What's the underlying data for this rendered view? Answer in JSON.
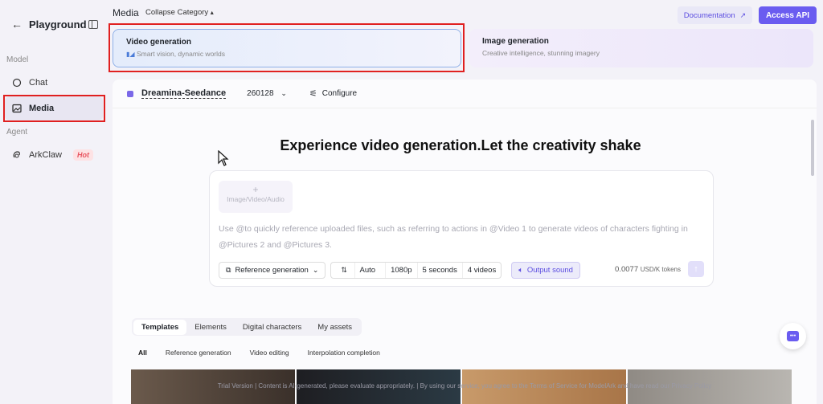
{
  "sidebar": {
    "title": "Playground",
    "sections": {
      "model": "Model",
      "agent": "Agent"
    },
    "items": [
      {
        "label": "Chat"
      },
      {
        "label": "Media"
      },
      {
        "label": "ArkClaw",
        "badge": "Hot"
      }
    ]
  },
  "header": {
    "title": "Media",
    "collapse_label": "Collapse Category",
    "documentation_label": "Documentation",
    "access_api_label": "Access API"
  },
  "categories": [
    {
      "title": "Video generation",
      "subtitle": "Smart vision, dynamic worlds"
    },
    {
      "title": "Image generation",
      "subtitle": "Creative intelligence, stunning imagery"
    }
  ],
  "model_bar": {
    "model_name": "Dreamina-Seedance",
    "version": "260128",
    "configure_label": "Configure"
  },
  "main": {
    "hero_title": "Experience video generation.Let the creativity shake",
    "upload_label": "Image/Video/Audio",
    "prompt_placeholder": "Use @to quickly reference uploaded files, such as referring to actions in @Video 1 to generate videos of characters fighting in @Pictures 2 and @Pictures 3.",
    "options": {
      "mode": "Reference generation",
      "ratio": "Auto",
      "resolution": "1080p",
      "duration": "5 seconds",
      "count": "4 videos",
      "output_sound": "Output sound"
    },
    "price": "0.0077",
    "price_unit": "USD/K tokens"
  },
  "tabs": [
    "Templates",
    "Elements",
    "Digital characters",
    "My assets"
  ],
  "filters": [
    "All",
    "Reference generation",
    "Video editing",
    "Interpolation completion"
  ],
  "footer_note": "Trial Version | Content is AI-generated, please evaluate appropriately. | By using our service, you agree to the Terms of Service for ModelArk and have read our Privacy Policy",
  "colors": {
    "accent": "#6a5cf0",
    "highlight_border": "#e02020"
  }
}
